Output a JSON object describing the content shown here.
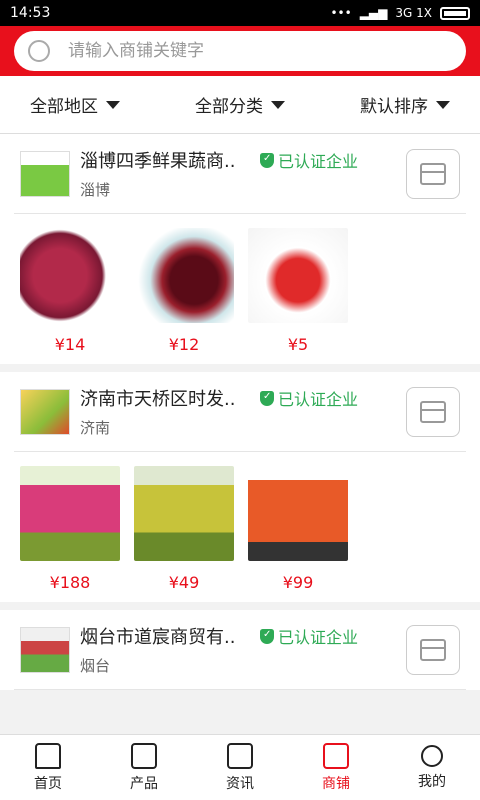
{
  "status": {
    "time": "14:53",
    "network": "3G 1X"
  },
  "search": {
    "placeholder": "请输入商铺关键字"
  },
  "filters": [
    {
      "label": "全部地区"
    },
    {
      "label": "全部分类"
    },
    {
      "label": "默认排序"
    }
  ],
  "stores": [
    {
      "name": "淄博四季鲜果蔬商..",
      "city": "淄博",
      "badge": "已认证企业",
      "products": [
        {
          "price": "¥14"
        },
        {
          "price": "¥12"
        },
        {
          "price": "¥5"
        }
      ]
    },
    {
      "name": "济南市天桥区时发..",
      "city": "济南",
      "badge": "已认证企业",
      "products": [
        {
          "price": "¥188"
        },
        {
          "price": "¥49"
        },
        {
          "price": "¥99"
        }
      ]
    },
    {
      "name": "烟台市道宸商贸有..",
      "city": "烟台",
      "badge": "已认证企业",
      "products": []
    }
  ],
  "tabs": [
    {
      "label": "首页"
    },
    {
      "label": "产品"
    },
    {
      "label": "资讯"
    },
    {
      "label": "商铺"
    },
    {
      "label": "我的"
    }
  ],
  "colors": {
    "accent": "#e8101c",
    "verified": "#2eaa55"
  }
}
